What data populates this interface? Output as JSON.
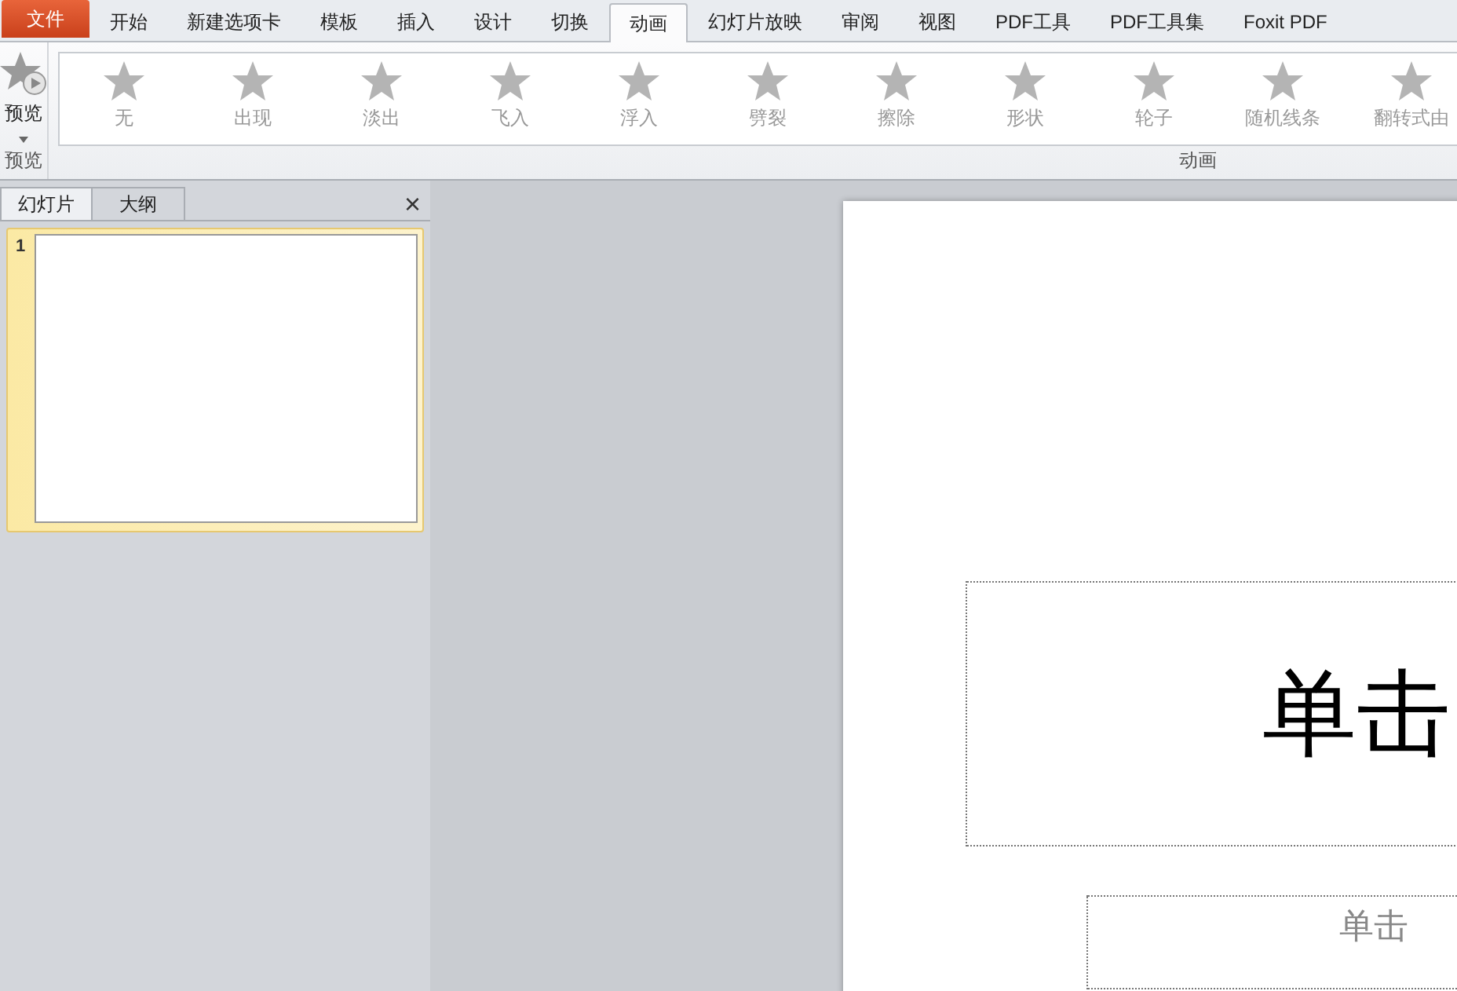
{
  "file_tab": {
    "label": "文件"
  },
  "ribbon_tabs": [
    {
      "label": "开始",
      "selected": false
    },
    {
      "label": "新建选项卡",
      "selected": false
    },
    {
      "label": "模板",
      "selected": false
    },
    {
      "label": "插入",
      "selected": false
    },
    {
      "label": "设计",
      "selected": false
    },
    {
      "label": "切换",
      "selected": false
    },
    {
      "label": "动画",
      "selected": true
    },
    {
      "label": "幻灯片放映",
      "selected": false
    },
    {
      "label": "审阅",
      "selected": false
    },
    {
      "label": "视图",
      "selected": false
    },
    {
      "label": "PDF工具",
      "selected": false
    },
    {
      "label": "PDF工具集",
      "selected": false
    },
    {
      "label": "Foxit PDF",
      "selected": false
    }
  ],
  "preview_group": {
    "button": "预览",
    "label": "预览"
  },
  "animation_group": {
    "label": "动画",
    "effects": [
      {
        "label": "无"
      },
      {
        "label": "出现"
      },
      {
        "label": "淡出"
      },
      {
        "label": "飞入"
      },
      {
        "label": "浮入"
      },
      {
        "label": "劈裂"
      },
      {
        "label": "擦除"
      },
      {
        "label": "形状"
      },
      {
        "label": "轮子"
      },
      {
        "label": "随机线条"
      },
      {
        "label": "翻转式由"
      }
    ]
  },
  "side_panel": {
    "tabs": [
      {
        "label": "幻灯片",
        "selected": true
      },
      {
        "label": "大纲",
        "selected": false
      }
    ],
    "close": "×",
    "slides": [
      {
        "number": "1",
        "selected": true
      }
    ]
  },
  "slide": {
    "title": "单击",
    "subtitle": "单击"
  }
}
